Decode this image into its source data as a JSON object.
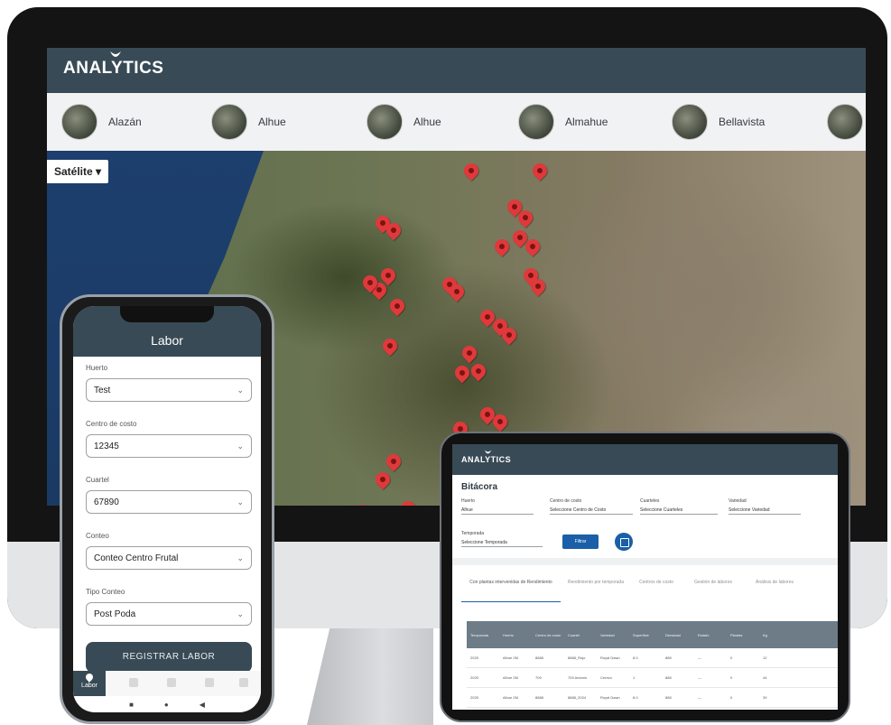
{
  "desktop": {
    "logo": "ANALYTICS",
    "farms": [
      "Alazán",
      "Alhue",
      "Alhue",
      "Almahue",
      "Bellavista"
    ],
    "map_type": "Satélite"
  },
  "phone": {
    "title": "Labor",
    "fields": [
      {
        "label": "Huerto",
        "value": "Test"
      },
      {
        "label": "Centro de costo",
        "value": "12345"
      },
      {
        "label": "Cuartel",
        "value": "67890"
      },
      {
        "label": "Conteo",
        "value": "Conteo Centro Frutal"
      },
      {
        "label": "Tipo Conteo",
        "value": "Post Poda"
      }
    ],
    "button": "REGISTRAR LABOR",
    "nav_active": "Labor"
  },
  "tablet": {
    "logo": "ANALYTICS",
    "title": "Bitácora",
    "filters": [
      {
        "label": "Huerto",
        "value": "Alhue"
      },
      {
        "label": "Centro de costo",
        "value": "Seleccione Centro de Costo"
      },
      {
        "label": "Cuarteles",
        "value": "Seleccione Cuarteles"
      },
      {
        "label": "Variedad",
        "value": "Seleccione Variedad"
      },
      {
        "label": "Temporada",
        "value": "Seleccione Temporada"
      }
    ],
    "filter_button": "Filtrar",
    "tabs": [
      "Con plantas intervenidas de Rendimiento",
      "Rendimiento por temporada",
      "Centros de costo",
      "Gestión de labores",
      "Análisis de labores"
    ],
    "table_headers": [
      "Temporada",
      "Huerto",
      "Centro de costo",
      "Cuartel",
      "Variedad",
      "Superficie",
      "Densidad",
      "Estado",
      "Plantas",
      "Kg"
    ],
    "rows": [
      [
        "2025",
        "Alhue 2M",
        "8888",
        "8888_Rojo",
        "Royal Dawn",
        "8.0",
        "888",
        "—",
        "0",
        "12"
      ],
      [
        "2025",
        "Alhue 2M",
        "709",
        "709 Antonio",
        "Cerezo",
        "1",
        "888",
        "—",
        "0",
        "44"
      ],
      [
        "2025",
        "Alhue 2M",
        "8888",
        "8888_2024",
        "Royal Dawn",
        "8.0",
        "888",
        "—",
        "0",
        "39"
      ]
    ]
  }
}
